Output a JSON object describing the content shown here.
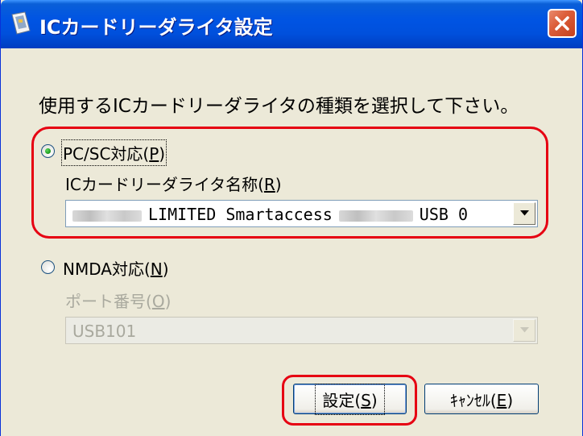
{
  "window": {
    "title": "ICカードリーダライタ設定",
    "close_icon": "close-icon"
  },
  "instruction": "使用するICカードリーダライタの種類を選択して下さい。",
  "options": {
    "pcsc": {
      "label_prefix": "PC/SC対応(",
      "accesskey": "P",
      "label_suffix": ")",
      "selected": true,
      "device_label_prefix": "ICカードリーダライタ名称(",
      "device_accesskey": "R",
      "device_label_suffix": ")",
      "device_value_1": "LIMITED Smartaccess",
      "device_value_2": "USB 0"
    },
    "nmda": {
      "label_prefix": "NMDA対応(",
      "accesskey": "N",
      "label_suffix": ")",
      "selected": false,
      "port_label_prefix": "ポート番号(",
      "port_accesskey": "O",
      "port_label_suffix": ")",
      "port_value": "USB101"
    }
  },
  "buttons": {
    "ok_prefix": "設定(",
    "ok_accesskey": "S",
    "ok_suffix": ")",
    "cancel_prefix": "ｷｬﾝｾﾙ(",
    "cancel_accesskey": "E",
    "cancel_suffix": ")"
  },
  "colors": {
    "title_bar": "#0054e3",
    "window_bg": "#ece9d8",
    "highlight": "#e60012"
  }
}
